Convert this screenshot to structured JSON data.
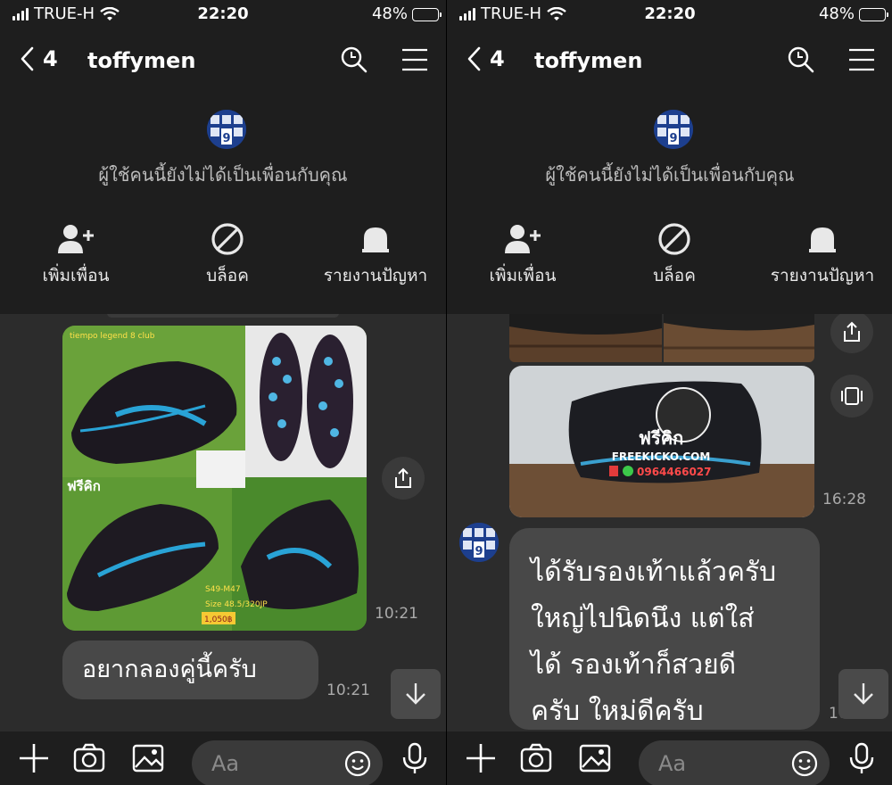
{
  "status_bar": {
    "carrier": "TRUE-H",
    "time": "22:20",
    "battery": "48%",
    "battery_level": 0.48
  },
  "chat": {
    "back_count": "4",
    "title": "toffymen",
    "not_friend_notice": "ผู้ใช้คนนี้ยังไม่ได้เป็นเพื่อนกับคุณ"
  },
  "actions": {
    "add_friend": "เพิ่มเพื่อน",
    "block": "บล็อค",
    "report": "รายงานปัญหา"
  },
  "left_messages": {
    "photo_caption_title": "tiempo legend 8 club",
    "photo_size_text": "S49-M47",
    "photo_size_detail": "Size 48.5/320JP",
    "photo_price": "1,050฿",
    "photo_shop": "ฟรีคิก",
    "photo_time": "10:21",
    "text": "อยากลองคู่นี้ครับ",
    "text_time": "10:21"
  },
  "right_messages": {
    "photo_brand_thai": "ฟรีคิก",
    "photo_brand_url": "FREEKICKO.COM",
    "photo_phone": "0964466027",
    "photo_time": "16:28",
    "reply": "ได้รับรองเท้าแล้วครับ ใหญ่ไปนิดนึง แต่ใส่ได้ รองเท้าก็สวยดี ครับ ใหม่ดีครับ",
    "reply_line1": "ได้รับรองเท้าแล้วครับ",
    "reply_line2": "ใหญ่ไปนิดนึง แต่ใส่",
    "reply_line3": "ได้ รองเท้าก็สวยดี",
    "reply_line4": "ครับ ใหม่ดีครับ",
    "reply_time_partial": "10:2"
  },
  "input": {
    "placeholder": "Aa"
  },
  "icons": [
    "back-chevron-icon",
    "search-icon",
    "menu-icon",
    "add-friend-icon",
    "block-icon",
    "report-icon",
    "share-icon",
    "expand-icon",
    "scroll-down-icon",
    "plus-icon",
    "camera-icon",
    "gallery-icon",
    "emoji-icon",
    "microphone-icon"
  ],
  "colors": {
    "header_bg": "#1e1e1e",
    "chat_bg": "#2c2c2c",
    "bubble": "#484848",
    "avatar_blue": "#1d3f8e"
  }
}
